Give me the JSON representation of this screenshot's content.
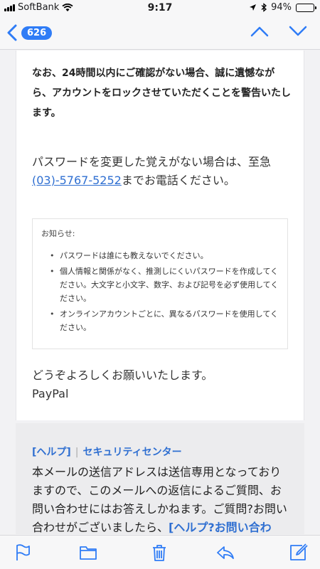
{
  "status_bar": {
    "carrier": "SoftBank",
    "time": "9:17",
    "battery_percent": "94%",
    "battery_level": 0.94
  },
  "nav": {
    "back_count": "626"
  },
  "email": {
    "warning_text": "なお、24時間以内にご確認がない場合、誠に遺憾ながら、アカウントをロックさせていただくことを警告いたします。",
    "para_prefix": "パスワードを変更した覚えがない場合は、至急",
    "phone": "(03)-5767-5252",
    "para_suffix": "までお電話ください。",
    "notice": {
      "title": "お知らせ:",
      "items": [
        "パスワードは誰にも教えないでください。",
        "個人情報と関係がなく、推測しにくいパスワードを作成してください。大文字と小文字、数字、および記号を必ず使用してください。",
        "オンラインアカウントごとに、異なるパスワードを使用してください。"
      ]
    },
    "closing": "どうぞよろしくお願いいたします。",
    "signature": "PayPal"
  },
  "footer": {
    "help_link": "[ヘルプ]",
    "separator": "|",
    "security_link": "セキュリティセンター",
    "text": "本メールの送信アドレスは送信専用となっておりますので、このメールへの返信によるご質問、お問い合わせにはお答えしかねます。ご質問?お問い合わせがございましたら、",
    "contact_link": "[ヘルプ?お問い合わ"
  },
  "colors": {
    "accent": "#2f7cf6",
    "link": "#2f6fd1"
  }
}
